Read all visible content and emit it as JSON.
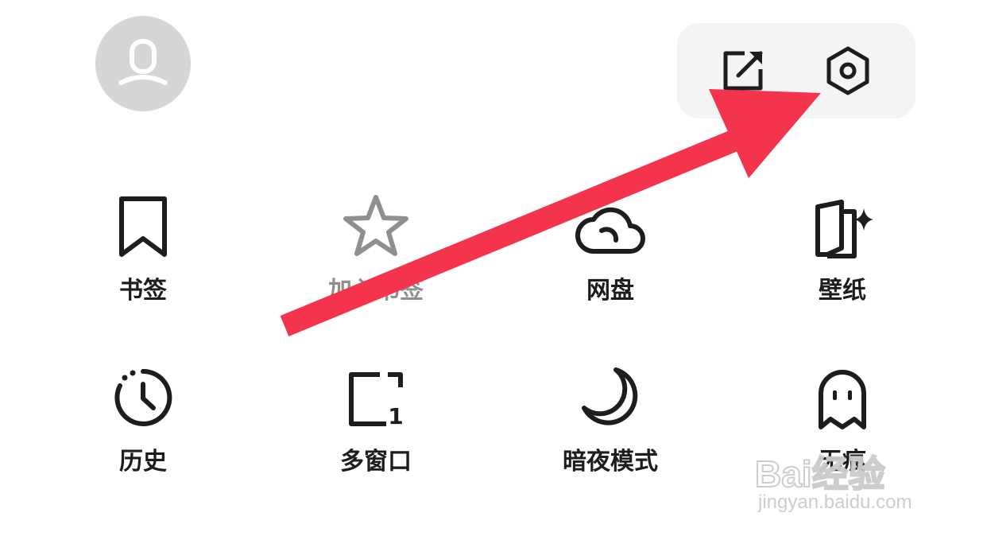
{
  "header": {
    "avatar": "user-avatar",
    "actions": [
      {
        "name": "share",
        "icon": "share-square-icon"
      },
      {
        "name": "settings",
        "icon": "hexagon-settings-icon"
      }
    ]
  },
  "menu": {
    "items": [
      {
        "label": "书签",
        "icon": "bookmark-icon",
        "enabled": true
      },
      {
        "label": "加入书签",
        "icon": "star-icon",
        "enabled": false
      },
      {
        "label": "网盘",
        "icon": "cloud-icon",
        "enabled": true
      },
      {
        "label": "壁纸",
        "icon": "wallpaper-icon",
        "enabled": true
      },
      {
        "label": "历史",
        "icon": "history-clock-icon",
        "enabled": true
      },
      {
        "label": "多窗口",
        "icon": "multi-window-icon",
        "enabled": true
      },
      {
        "label": "暗夜模式",
        "icon": "moon-icon",
        "enabled": true
      },
      {
        "label": "无痕",
        "icon": "ghost-icon",
        "enabled": true
      }
    ]
  },
  "multiwindow_count": "1",
  "annotation": {
    "color": "#f4344c",
    "points_to": "settings"
  },
  "watermark": {
    "logo": "Bai经验",
    "url": "jingyan.baidu.com"
  },
  "colors": {
    "icon": "#1d1d1d",
    "disabled": "#8f8f8f",
    "arrow": "#f4344c"
  }
}
